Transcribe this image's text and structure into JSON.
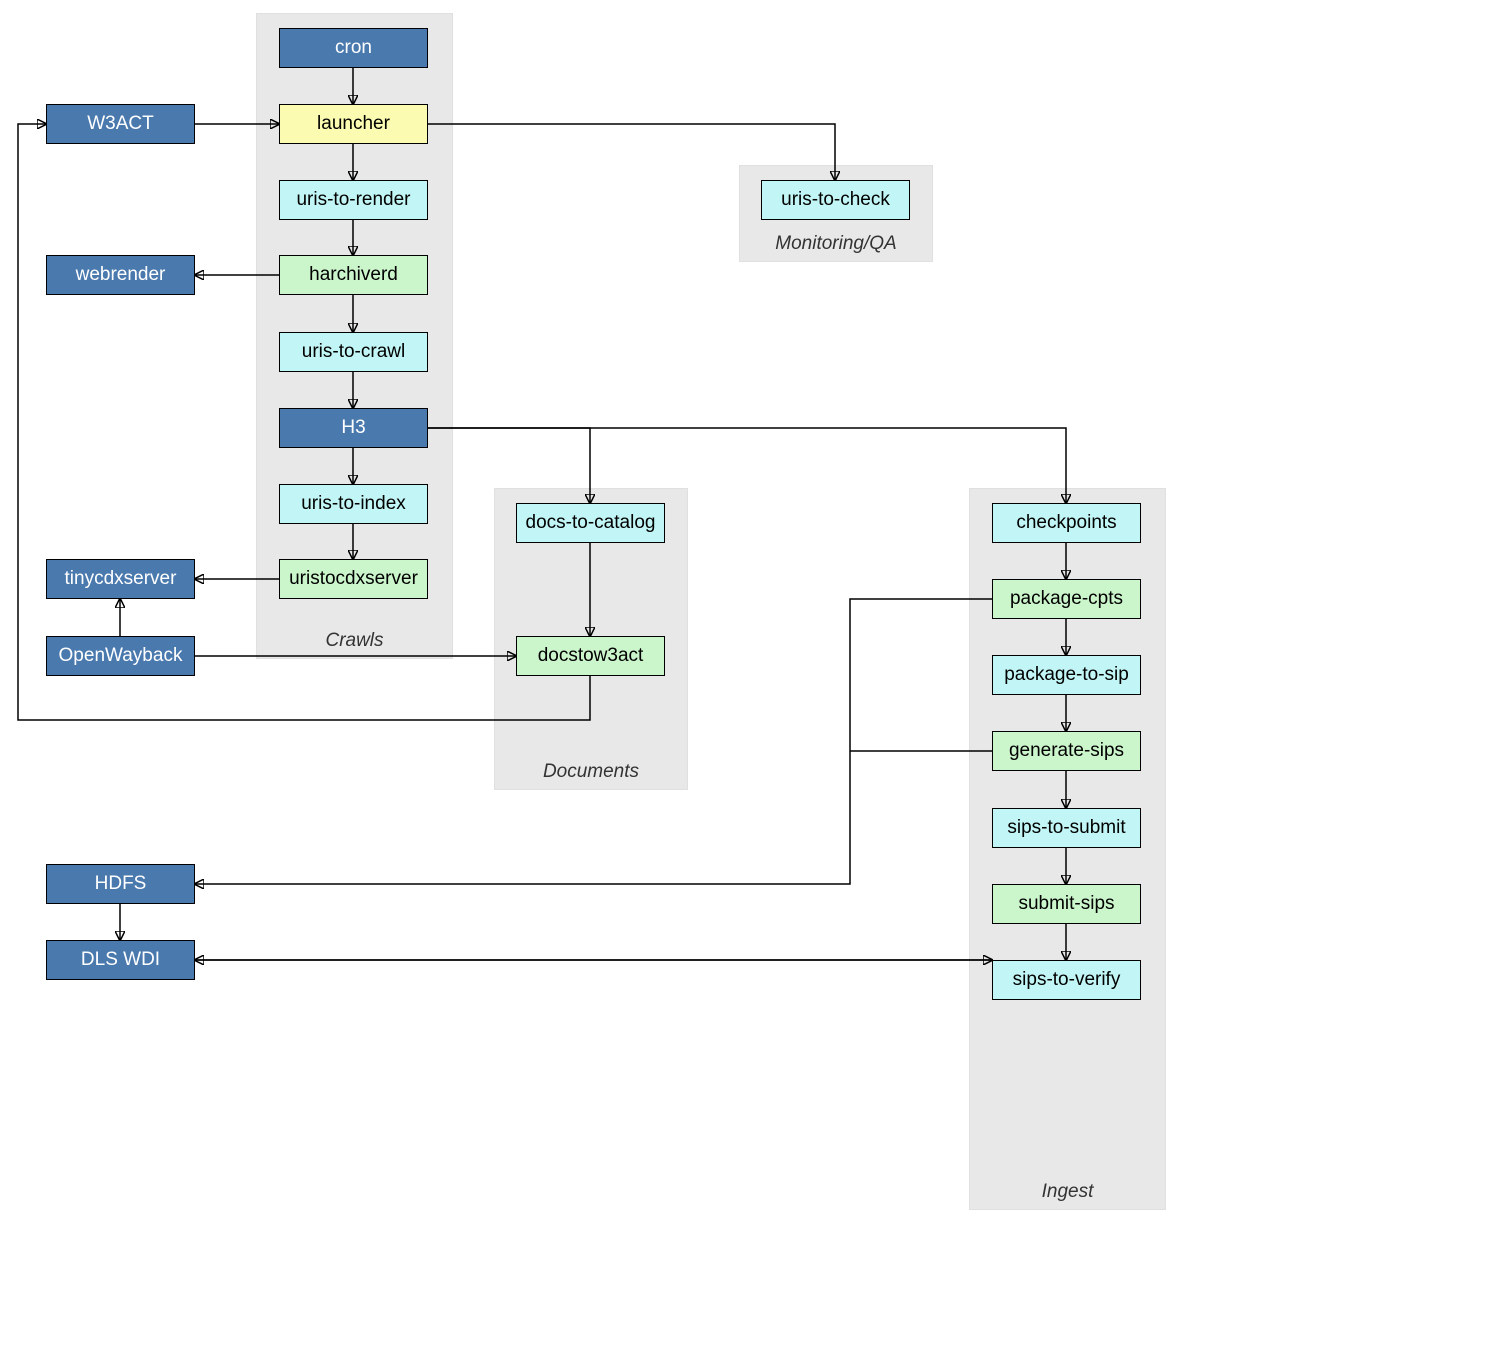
{
  "clusters": {
    "crawls": {
      "label": "Crawls"
    },
    "monitoring": {
      "label": "Monitoring/QA"
    },
    "documents": {
      "label": "Documents"
    },
    "ingest": {
      "label": "Ingest"
    }
  },
  "left": {
    "w3act": "W3ACT",
    "webrender": "webrender",
    "tinycdx": "tinycdxserver",
    "openwayback": "OpenWayback",
    "hdfs": "HDFS",
    "dlswdi": "DLS WDI"
  },
  "crawls": {
    "cron": "cron",
    "launcher": "launcher",
    "uris_render": "uris-to-render",
    "harchiverd": "harchiverd",
    "uris_crawl": "uris-to-crawl",
    "h3": "H3",
    "uris_index": "uris-to-index",
    "uristocdx": "uristocdxserver"
  },
  "monitoring": {
    "uris_check": "uris-to-check"
  },
  "documents": {
    "docs_catalog": "docs-to-catalog",
    "docstow3act": "docstow3act"
  },
  "ingest": {
    "checkpoints": "checkpoints",
    "package_cpts": "package-cpts",
    "package_sip": "package-to-sip",
    "generate_sips": "generate-sips",
    "sips_submit": "sips-to-submit",
    "submit_sips": "submit-sips",
    "sips_verify": "sips-to-verify"
  }
}
